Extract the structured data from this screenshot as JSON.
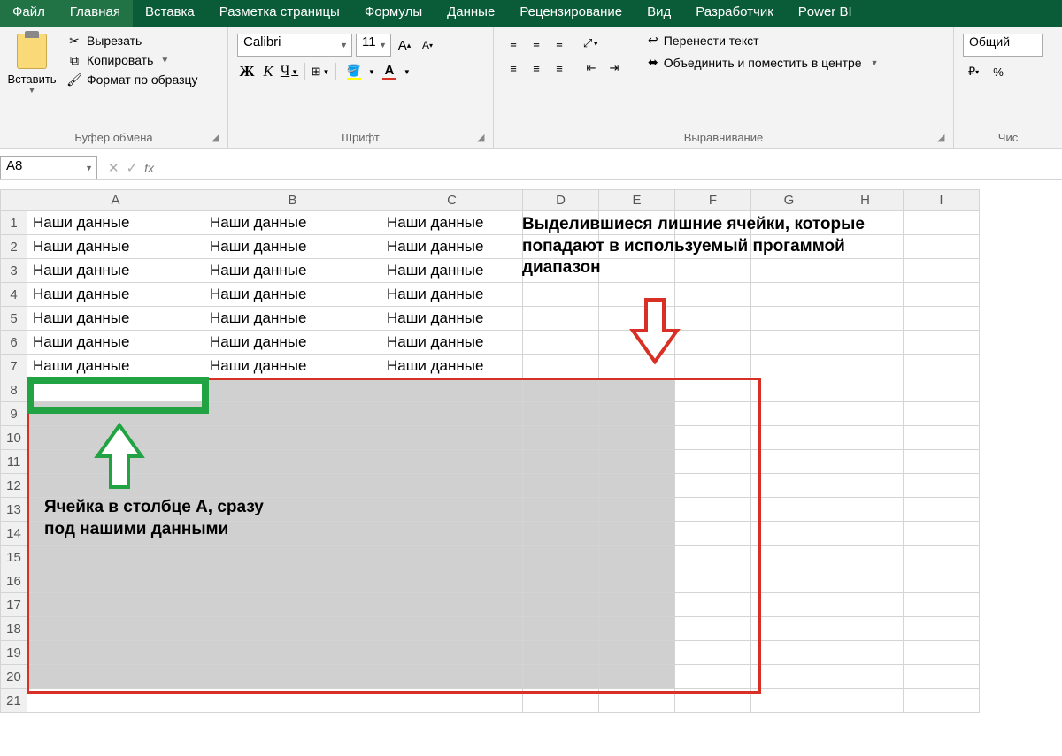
{
  "tabs": {
    "file": "Файл",
    "home": "Главная",
    "insert": "Вставка",
    "pagelayout": "Разметка страницы",
    "formulas": "Формулы",
    "data": "Данные",
    "review": "Рецензирование",
    "view": "Вид",
    "developer": "Разработчик",
    "powerbi": "Power BI"
  },
  "ribbon": {
    "clipboard": {
      "paste": "Вставить",
      "cut": "Вырезать",
      "copy": "Копировать",
      "format_painter": "Формат по образцу",
      "group_label": "Буфер обмена"
    },
    "font": {
      "name": "Calibri",
      "size": "11",
      "bold": "Ж",
      "italic": "К",
      "underline": "Ч",
      "group_label": "Шрифт"
    },
    "alignment": {
      "wrap": "Перенести текст",
      "merge": "Объединить и поместить в центре",
      "group_label": "Выравнивание"
    },
    "number": {
      "format": "Общий",
      "percent": "%",
      "group_label": "Чис"
    }
  },
  "namebox": "A8",
  "columns": [
    "A",
    "B",
    "C",
    "D",
    "E",
    "F",
    "G",
    "H",
    "I"
  ],
  "rows": [
    "1",
    "2",
    "3",
    "4",
    "5",
    "6",
    "7",
    "8",
    "9",
    "10",
    "11",
    "12",
    "13",
    "14",
    "15",
    "16",
    "17",
    "18",
    "19",
    "20",
    "21"
  ],
  "cell_text": "Наши данные",
  "annotation_top": "Выделившиеся лишние ячейки, которые попадают в используемый прогаммой диапазон",
  "annotation_bottom": "Ячейка в столбце А, сразу под нашими данными"
}
